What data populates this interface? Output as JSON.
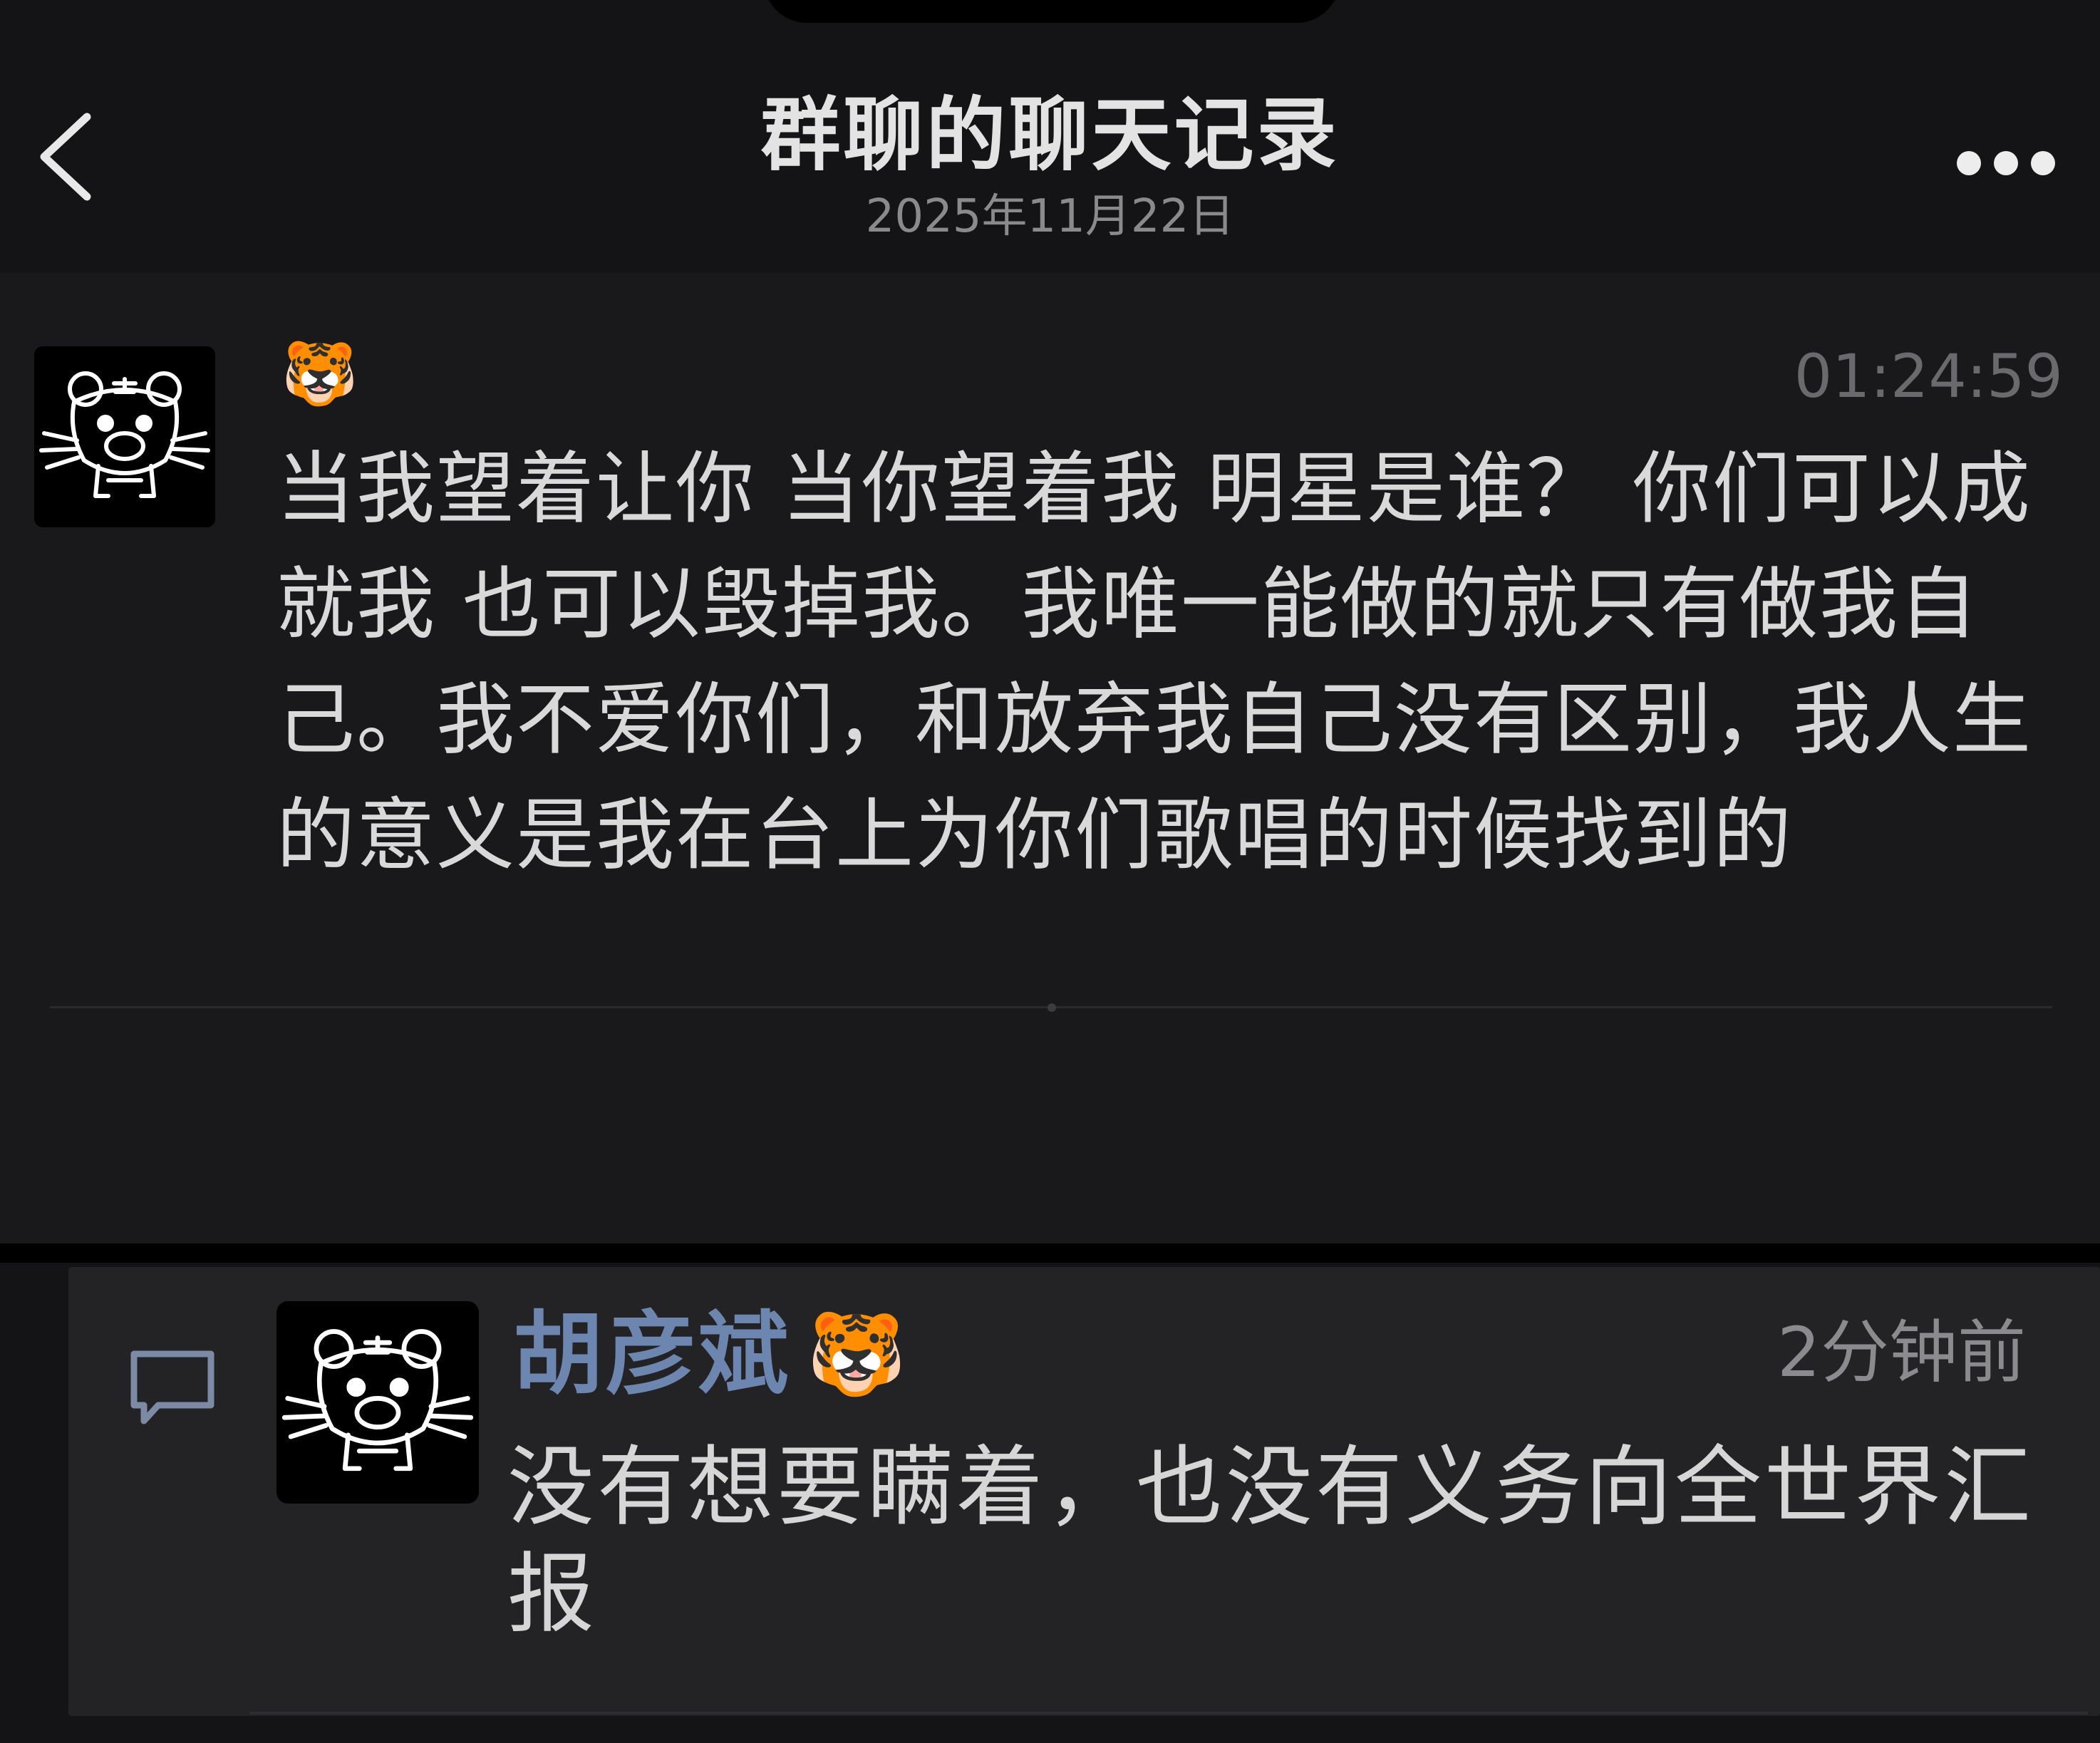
{
  "header": {
    "title": "群聊的聊天记录",
    "date": "2025年11月22日"
  },
  "icons": {
    "back": "chevron-left-icon",
    "more": "more-dots-icon",
    "avatar": "tiger-doodle-avatar",
    "comment": "comment-bubble-icon"
  },
  "message": {
    "sender_emoji": "🐯",
    "time": "01:24:59",
    "text": "当我望着让你 当你望着我 明星是谁？ 你们可以成就我 也可以毁掉我。我唯一能做的就只有做我自己。我不爱你们，和放弃我自己没有区别，我人生的意义是我在台上为你们歌唱的时候找到的"
  },
  "comment": {
    "author": "胡彦斌",
    "author_emoji": "🐯",
    "time": "2分钟前",
    "text": "没有想要瞒着，也没有义务向全世界汇报"
  },
  "colors": {
    "background": "#19191b",
    "nav_background": "#141416",
    "card_background": "#232326",
    "author_name": "#6c86b0",
    "text": "#d9d9d9",
    "muted": "#8a8a8c"
  }
}
